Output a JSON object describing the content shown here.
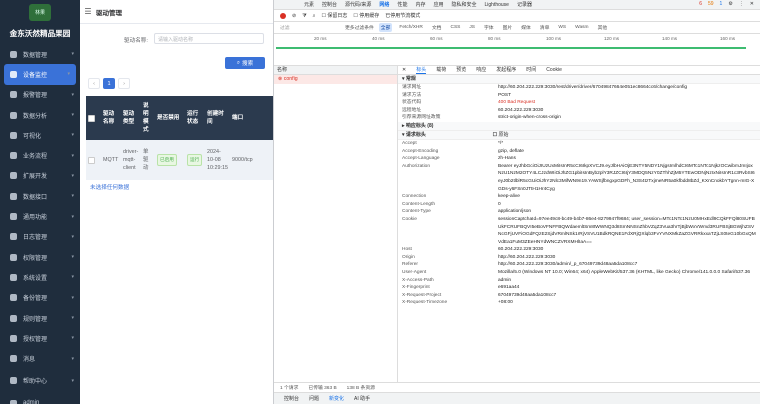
{
  "sidebar": {
    "brand": "金东沃然精品果园",
    "logo_text": "林果",
    "items": [
      {
        "label": "数据管理"
      },
      {
        "label": "设备监控"
      },
      {
        "label": "报警管理"
      },
      {
        "label": "数据分析"
      },
      {
        "label": "可视化"
      },
      {
        "label": "业务流程"
      },
      {
        "label": "扩展开发"
      },
      {
        "label": "数据接口"
      },
      {
        "label": "通用功能"
      },
      {
        "label": "日志管理"
      },
      {
        "label": "权限管理"
      },
      {
        "label": "系统设置"
      },
      {
        "label": "备份管理"
      },
      {
        "label": "规则管理"
      },
      {
        "label": "授权管理"
      },
      {
        "label": "消息"
      },
      {
        "label": "帮助中心"
      },
      {
        "label": "admin"
      }
    ]
  },
  "main": {
    "breadcrumb": "驱动管理",
    "filter_label": "驱动名称:",
    "filter_placeholder": "请输入驱动名称",
    "search_label": "搜索",
    "page_current": "1",
    "columns": [
      "驱动名称",
      "驱动类型",
      "说明模式",
      "是否禁用",
      "运行状态",
      "创建时间",
      "端口"
    ],
    "rows": [
      {
        "name": "MQTT",
        "type": "driver-mqtt-client",
        "mode": "单驱动",
        "disabled": "已启用",
        "status": "运行",
        "created": "2024-10-08 10:29:15",
        "port": "9000/tcp"
      }
    ],
    "more_link": "未选择任何数据"
  },
  "devtools": {
    "tabs": [
      "元素",
      "控制台",
      "源代码/来源",
      "网络",
      "性能",
      "内存",
      "应用",
      "隐私和安全",
      "Lighthouse",
      "记录器"
    ],
    "active_tab": "网络",
    "counts": {
      "errors": "6",
      "warnings": "59",
      "info": "1"
    },
    "toolbar": {
      "preserve_log": "保留日志",
      "disable_cache": "停用缓存",
      "throttle": "已停用节流模式"
    },
    "filter": {
      "placeholder": "过滤",
      "more": "更多过滤条件",
      "types": [
        "全部",
        "Fetch/XHR",
        "文档",
        "CSS",
        "JS",
        "字体",
        "图片",
        "媒体",
        "清单",
        "WS",
        "Wasm",
        "其他"
      ]
    },
    "timeline_labels": [
      "20 ms",
      "40 ms",
      "60 ms",
      "80 ms",
      "100 ms",
      "120 ms",
      "140 ms",
      "160 ms"
    ],
    "list_header": "名称",
    "request_name": "config",
    "detail_tabs": [
      "标头",
      "载荷",
      "预览",
      "响应",
      "发起程序",
      "时间",
      "Cookie"
    ],
    "general_title": "常规",
    "general": [
      {
        "k": "请求网址",
        "v": "http://60.204.222.229:3030/rest/driver/driver/67049847664e051ec8664cc6/change/config"
      },
      {
        "k": "请求方法",
        "v": "POST"
      },
      {
        "k": "状态代码",
        "v": "400 Bad Request"
      },
      {
        "k": "远程地址",
        "v": "60.204.222.229:3030"
      },
      {
        "k": "引荐来源网址政策",
        "v": "strict-origin-when-cross-origin"
      }
    ],
    "response_headers_title": "响应标头 (8)",
    "request_headers_title": "请求标头",
    "raw_label": "原始",
    "request_headers": [
      {
        "k": "Accept",
        "v": "*/*"
      },
      {
        "k": "Accept-Encoding",
        "v": "gzip, deflate"
      },
      {
        "k": "Accept-Language",
        "v": "zh-Hans"
      },
      {
        "k": "Authorization",
        "v": "Bearer eyJhbGciOiJIUzUxMiIsInR5cCI6IkpXVCJ9.eyJlbHAiOjE3NTY5NDY1NjgsImlhdCI6MTc1NTc1NjkzOCwibmJmIjoxNzU1NzM2OTY4LCJzdWIiOiJhZG1pbiIsInByb2plY3RJZCI6IjY3MDQ5NzY0ZThhZjM5YTEwODNjNzIxNiIsInR1c3RvbSI6eyJ0b2tlblR5cGUiOiJhY2Nlc3MifWN9n19.YAWSjfbngxpGDFh_N3S4tzTxjmeNR5a0kfbdd8bZd_KXnCnokbYTgnn-mIG-XGDs-y6FSn0JTtH1Hr4Cyg"
      },
      {
        "k": "Connection",
        "v": "keep-alive"
      },
      {
        "k": "Content-Length",
        "v": "0"
      },
      {
        "k": "Content-Type",
        "v": "application/json"
      },
      {
        "k": "Cookie",
        "v": "sessionCaptchaId=97ee49c8-bc49-b4b7-86e4-8279947f9684; user_session=MTc1NTc1NzU0MHxEdl9CQkFFQl80SUFBUkFCRUFBQVI5eBoVFNFFBQWdaemltSm8tWWNQ3d8SmNNSnZhbVZqZ3Vua3hrTjBjbWxVWmd3RUFBSjBGWjhZSVNcGFjUVFiOGdFQzE2SjdVRmlNSk1rRjVSVU1BdkRQNE1FdXRjQXlqb3FvYVNXMkZaZGVRRkxxaTZjLS0teG10bGxQMVdEa1FuM3ZEeHNYdWNCZVRXMHlIaA=="
      },
      {
        "k": "Host",
        "v": "60.204.222.229:3030"
      },
      {
        "k": "Origin",
        "v": "http://60.204.222.229:3030"
      },
      {
        "k": "Referer",
        "v": "http://60.204.222.229:3030/admin/_p_67049739d48aa5da108cc7"
      },
      {
        "k": "User-Agent",
        "v": "Mozilla/5.0 (Windows NT 10.0; Win64; x64) AppleWebKit/537.36 (KHTML, like Gecko) Chrome/141.0.0.0 Safari/537.36"
      },
      {
        "k": "X-Access-Path",
        "v": "admin"
      },
      {
        "k": "X-Fingerprint",
        "v": "e691aa44"
      },
      {
        "k": "X-Request-Project",
        "v": "67049739d48aa5da108cc7"
      },
      {
        "k": "X-Request-Timezone",
        "v": "+08:00"
      }
    ],
    "status": {
      "requests": "1 个请求",
      "transferred": "已传输 363 B",
      "resources": "138 B 条资源"
    },
    "drawer_tabs": [
      "控制台",
      "问题",
      "新变化",
      "AI 助手"
    ]
  }
}
